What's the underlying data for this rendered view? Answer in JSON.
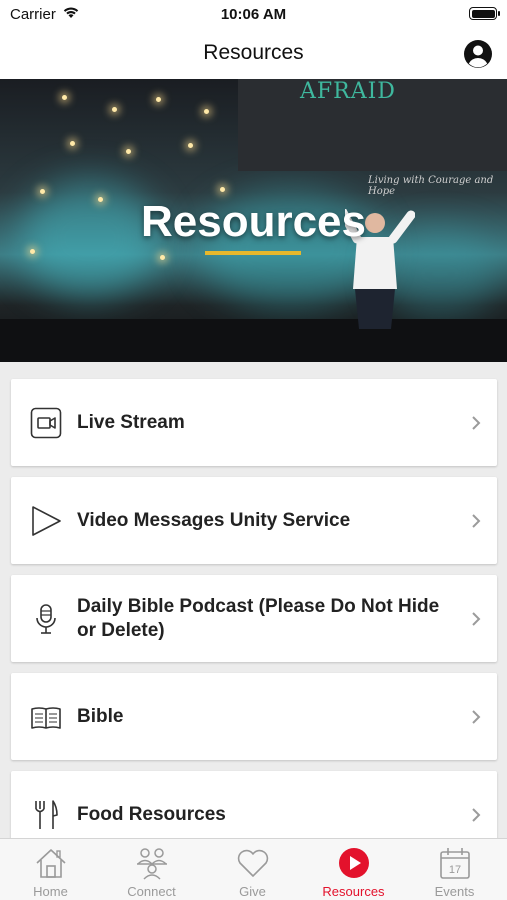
{
  "status_bar": {
    "carrier": "Carrier",
    "time": "10:06 AM"
  },
  "nav": {
    "title": "Resources"
  },
  "hero": {
    "title": "Resources",
    "screen_text": "AFRAID",
    "screen_subtitle": "Living with Courage and Hope",
    "accent_color": "#e6b82c"
  },
  "list": {
    "items": [
      {
        "label": "Live Stream",
        "icon": "video-camera-icon"
      },
      {
        "label": "Video Messages Unity Service",
        "icon": "play-icon"
      },
      {
        "label": "Daily Bible Podcast (Please Do Not Hide or Delete)",
        "icon": "microphone-icon"
      },
      {
        "label": "Bible",
        "icon": "book-icon"
      },
      {
        "label": "Food Resources",
        "icon": "fork-knife-icon"
      }
    ]
  },
  "tabs": [
    {
      "label": "Home",
      "icon": "home-icon",
      "active": false
    },
    {
      "label": "Connect",
      "icon": "people-icon",
      "active": false
    },
    {
      "label": "Give",
      "icon": "heart-icon",
      "active": false
    },
    {
      "label": "Resources",
      "icon": "play-circle-icon",
      "active": true
    },
    {
      "label": "Events",
      "icon": "calendar-icon",
      "active": false
    }
  ],
  "colors": {
    "active_tab": "#e3122c",
    "inactive_tab": "#9a9a9a"
  }
}
